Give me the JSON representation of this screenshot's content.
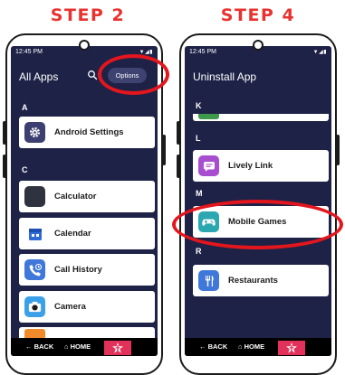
{
  "steps": [
    {
      "title": "STEP 2",
      "status_time": "12:45 PM",
      "header_title": "All Apps",
      "options_label": "Options",
      "sections": [
        {
          "letter": "A",
          "items": [
            {
              "label": "Android Settings",
              "icon": "gear-icon"
            }
          ]
        },
        {
          "letter": "C",
          "items": [
            {
              "label": "Calculator",
              "icon": "calculator-icon"
            },
            {
              "label": "Calendar",
              "icon": "calendar-icon"
            },
            {
              "label": "Call History",
              "icon": "call-history-icon"
            },
            {
              "label": "Camera",
              "icon": "camera-icon"
            }
          ]
        }
      ]
    },
    {
      "title": "STEP 4",
      "status_time": "12:45 PM",
      "header_title": "Uninstall App",
      "sections": [
        {
          "letter": "K",
          "items": []
        },
        {
          "letter": "L",
          "items": [
            {
              "label": "Lively Link",
              "icon": "chat-icon"
            }
          ]
        },
        {
          "letter": "M",
          "items": [
            {
              "label": "Mobile Games",
              "icon": "gamepad-icon"
            }
          ]
        },
        {
          "letter": "R",
          "items": [
            {
              "label": "Restaurants",
              "icon": "utensils-icon"
            }
          ]
        }
      ]
    }
  ],
  "navbar": {
    "back_label": "BACK",
    "home_label": "HOME",
    "star_icon": "lively-star-icon"
  },
  "colors": {
    "screen_bg": "#1e2247",
    "highlight_ring": "#e4161d",
    "step_title": "#e8322f",
    "nav_star_bg": "#e2325b"
  }
}
